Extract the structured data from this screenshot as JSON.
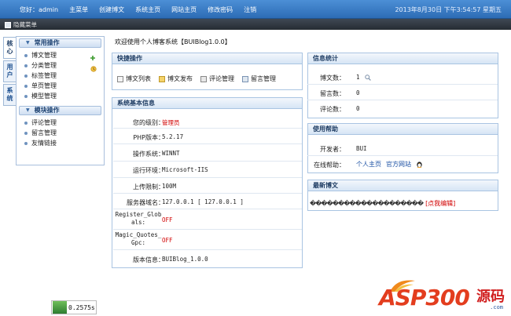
{
  "topbar": {
    "nav": [
      "您好：admin",
      "主菜单",
      "创建博文",
      "系统主页",
      "网站主页",
      "修改密码",
      "注销"
    ],
    "clock": "2013年8月30日 下午3:54:57 星期五"
  },
  "subbar": {
    "hide_label": "隐藏菜单"
  },
  "vtabs": [
    "核心",
    "用户",
    "系统"
  ],
  "leftmenu": {
    "common_title": "常用操作",
    "common_items": [
      "博文管理",
      "分类管理",
      "标签管理",
      "单页管理",
      "模型管理"
    ],
    "module_title": "模块操作",
    "module_items": [
      "评论管理",
      "留言管理",
      "友情链接"
    ]
  },
  "welcome": "欢迎使用个人博客系统【BUIBlog1.0.0】",
  "quick": {
    "title": "快捷操作",
    "items": [
      "博文列表",
      "博文发布",
      "评论管理",
      "留言管理"
    ]
  },
  "sysinfo": {
    "title": "系统基本信息",
    "rows": [
      {
        "k": "您的级别：",
        "v": "管理员",
        "red": true
      },
      {
        "k": "PHP版本：",
        "v": "5.2.17"
      },
      {
        "k": "操作系统：",
        "v": "WINNT"
      },
      {
        "k": "运行环境：",
        "v": "Microsoft-IIS"
      },
      {
        "k": "上传限制：",
        "v": "100M"
      },
      {
        "k": "服务器域名：",
        "v": "127.0.0.1 [ 127.0.0.1 ]"
      },
      {
        "k": "Register_Globals:",
        "v": "OFF",
        "red": true
      },
      {
        "k": "Magic_Quotes_Gpc:",
        "v": "OFF",
        "red": true
      },
      {
        "k": "版本信息：",
        "v": "BUIBlog_1.0.0"
      }
    ]
  },
  "stats": {
    "title": "信息统计",
    "rows": [
      {
        "k": "博文数：",
        "v": "1"
      },
      {
        "k": "留言数：",
        "v": "0"
      },
      {
        "k": "评论数：",
        "v": "0"
      }
    ]
  },
  "help": {
    "title": "使用帮助",
    "developer_k": "开发者：",
    "developer_v": "BUI",
    "online_k": "在线帮助：",
    "links": [
      "个人主页",
      "官方网站"
    ]
  },
  "latest": {
    "title": "最新博文",
    "post": "��������������������",
    "edit": "[点我编辑]"
  },
  "footer": {
    "time": "0.2575s"
  },
  "watermark": {
    "brand": "ASP300",
    "cn": "源码",
    "com": ".com"
  }
}
